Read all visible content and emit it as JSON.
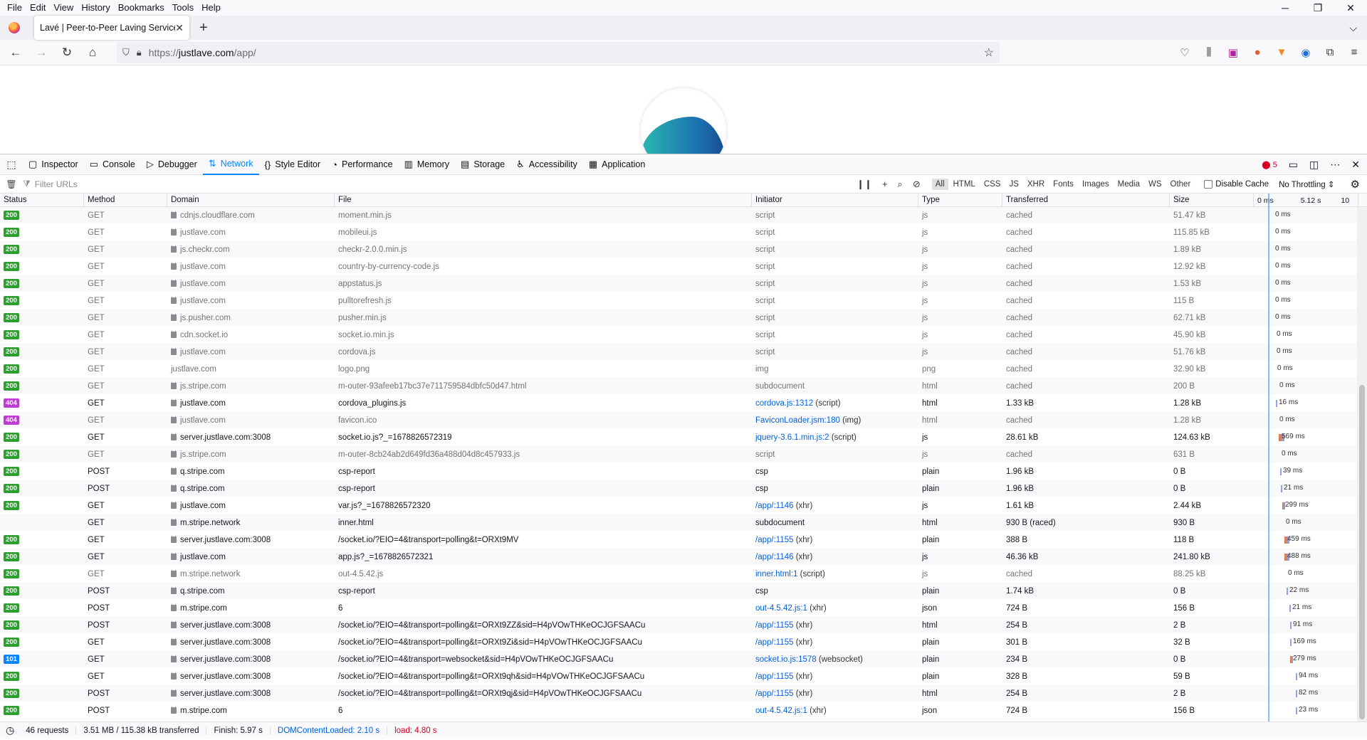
{
  "menubar": {
    "items": [
      "File",
      "Edit",
      "View",
      "History",
      "Bookmarks",
      "Tools",
      "Help"
    ]
  },
  "tab": {
    "title": "Lavé | Peer-to-Peer Laving Service"
  },
  "urlbar": {
    "url_prefix": "https://",
    "url_domain": "justlave.com",
    "url_path": "/app/"
  },
  "devtools": {
    "tabs": [
      "Inspector",
      "Console",
      "Debugger",
      "Network",
      "Style Editor",
      "Performance",
      "Memory",
      "Storage",
      "Accessibility",
      "Application"
    ],
    "active_tab": "Network",
    "error_count": "5",
    "filter_placeholder": "Filter URLs",
    "type_filters": [
      "All",
      "HTML",
      "CSS",
      "JS",
      "XHR",
      "Fonts",
      "Images",
      "Media",
      "WS",
      "Other"
    ],
    "disable_cache": "Disable Cache",
    "throttling": "No Throttling ⇕"
  },
  "columns": {
    "status": "Status",
    "method": "Method",
    "domain": "Domain",
    "file": "File",
    "initiator": "Initiator",
    "type": "Type",
    "transferred": "Transferred",
    "size": "Size",
    "wf_0": "0 ms",
    "wf_1": "5.12 s",
    "wf_2": "10"
  },
  "colors": {
    "ok": "#2e9e2e",
    "not_found": "#c03ad5",
    "switching": "#0a84ff"
  },
  "rows": [
    {
      "status": "200",
      "method": "GET",
      "secure": true,
      "domain": "cdnjs.cloudflare.com",
      "file": "moment.min.js",
      "init_link": "",
      "init_cause": "script",
      "type": "js",
      "transferred": "cached",
      "size": "51.47 kB",
      "cached": true,
      "wf_pos": 0.18,
      "wf_time": "0 ms"
    },
    {
      "status": "200",
      "method": "GET",
      "secure": true,
      "domain": "justlave.com",
      "file": "mobileui.js",
      "init_link": "",
      "init_cause": "script",
      "type": "js",
      "transferred": "cached",
      "size": "115.85 kB",
      "cached": true,
      "wf_pos": 0.18,
      "wf_time": "0 ms"
    },
    {
      "status": "200",
      "method": "GET",
      "secure": true,
      "domain": "js.checkr.com",
      "file": "checkr-2.0.0.min.js",
      "init_link": "",
      "init_cause": "script",
      "type": "js",
      "transferred": "cached",
      "size": "1.89 kB",
      "cached": true,
      "wf_pos": 0.18,
      "wf_time": "0 ms"
    },
    {
      "status": "200",
      "method": "GET",
      "secure": true,
      "domain": "justlave.com",
      "file": "country-by-currency-code.js",
      "init_link": "",
      "init_cause": "script",
      "type": "js",
      "transferred": "cached",
      "size": "12.92 kB",
      "cached": true,
      "wf_pos": 0.18,
      "wf_time": "0 ms"
    },
    {
      "status": "200",
      "method": "GET",
      "secure": true,
      "domain": "justlave.com",
      "file": "appstatus.js",
      "init_link": "",
      "init_cause": "script",
      "type": "js",
      "transferred": "cached",
      "size": "1.53 kB",
      "cached": true,
      "wf_pos": 0.18,
      "wf_time": "0 ms"
    },
    {
      "status": "200",
      "method": "GET",
      "secure": true,
      "domain": "justlave.com",
      "file": "pulltorefresh.js",
      "init_link": "",
      "init_cause": "script",
      "type": "js",
      "transferred": "cached",
      "size": "115 B",
      "cached": true,
      "wf_pos": 0.18,
      "wf_time": "0 ms"
    },
    {
      "status": "200",
      "method": "GET",
      "secure": true,
      "domain": "js.pusher.com",
      "file": "pusher.min.js",
      "init_link": "",
      "init_cause": "script",
      "type": "js",
      "transferred": "cached",
      "size": "62.71 kB",
      "cached": true,
      "wf_pos": 0.18,
      "wf_time": "0 ms"
    },
    {
      "status": "200",
      "method": "GET",
      "secure": true,
      "domain": "cdn.socket.io",
      "file": "socket.io.min.js",
      "init_link": "",
      "init_cause": "script",
      "type": "js",
      "transferred": "cached",
      "size": "45.90 kB",
      "cached": true,
      "wf_pos": 0.19,
      "wf_time": "0 ms"
    },
    {
      "status": "200",
      "method": "GET",
      "secure": true,
      "domain": "justlave.com",
      "file": "cordova.js",
      "init_link": "",
      "init_cause": "script",
      "type": "js",
      "transferred": "cached",
      "size": "51.76 kB",
      "cached": true,
      "wf_pos": 0.19,
      "wf_time": "0 ms"
    },
    {
      "status": "200",
      "method": "GET",
      "secure": false,
      "domain": "justlave.com",
      "file": "logo.png",
      "init_link": "",
      "init_cause": "img",
      "type": "png",
      "transferred": "cached",
      "size": "32.90 kB",
      "cached": true,
      "wf_pos": 0.2,
      "wf_time": "0 ms"
    },
    {
      "status": "200",
      "method": "GET",
      "secure": true,
      "domain": "js.stripe.com",
      "file": "m-outer-93afeeb17bc37e711759584dbfc50d47.html",
      "init_link": "",
      "init_cause": "subdocument",
      "type": "html",
      "transferred": "cached",
      "size": "200 B",
      "cached": true,
      "wf_pos": 0.22,
      "wf_time": "0 ms"
    },
    {
      "status": "404",
      "method": "GET",
      "secure": true,
      "domain": "justlave.com",
      "file": "cordova_plugins.js",
      "init_link": "cordova.js:1312",
      "init_cause": " (script)",
      "type": "html",
      "transferred": "1.33 kB",
      "size": "1.28 kB",
      "cached": false,
      "wf_pos": 0.21,
      "wf_time": "16 ms"
    },
    {
      "status": "404",
      "method": "GET",
      "secure": true,
      "domain": "justlave.com",
      "file": "favicon.ico",
      "init_link": "FaviconLoader.jsm:180",
      "init_cause": " (img)",
      "type": "html",
      "transferred": "cached",
      "size": "1.28 kB",
      "cached": true,
      "wf_pos": 0.22,
      "wf_time": "0 ms"
    },
    {
      "status": "200",
      "method": "GET",
      "secure": true,
      "domain": "server.justlave.com:3008",
      "file": "socket.io.js?_=1678826572319",
      "init_link": "jquery-3.6.1.min.js:2",
      "init_cause": " (script)",
      "type": "js",
      "transferred": "28.61 kB",
      "size": "124.63 kB",
      "cached": false,
      "wf_pos": 0.24,
      "wf_time": "569 ms"
    },
    {
      "status": "200",
      "method": "GET",
      "secure": true,
      "domain": "js.stripe.com",
      "file": "m-outer-8cb24ab2d649fd36a488d04d8c457933.js",
      "init_link": "",
      "init_cause": "script",
      "type": "js",
      "transferred": "cached",
      "size": "631 B",
      "cached": true,
      "wf_pos": 0.24,
      "wf_time": "0 ms"
    },
    {
      "status": "200",
      "method": "POST",
      "secure": true,
      "domain": "q.stripe.com",
      "file": "csp-report",
      "init_link": "",
      "init_cause": "csp",
      "type": "plain",
      "transferred": "1.96 kB",
      "size": "0 B",
      "cached": false,
      "wf_pos": 0.25,
      "wf_time": "39 ms"
    },
    {
      "status": "200",
      "method": "POST",
      "secure": true,
      "domain": "q.stripe.com",
      "file": "csp-report",
      "init_link": "",
      "init_cause": "csp",
      "type": "plain",
      "transferred": "1.96 kB",
      "size": "0 B",
      "cached": false,
      "wf_pos": 0.26,
      "wf_time": "21 ms"
    },
    {
      "status": "200",
      "method": "GET",
      "secure": true,
      "domain": "justlave.com",
      "file": "var.js?_=1678826572320",
      "init_link": "/app/:1146",
      "init_cause": " (xhr)",
      "type": "js",
      "transferred": "1.61 kB",
      "size": "2.44 kB",
      "cached": false,
      "wf_pos": 0.27,
      "wf_time": "299 ms"
    },
    {
      "status": "",
      "method": "GET",
      "secure": true,
      "domain": "m.stripe.network",
      "file": "inner.html",
      "init_link": "",
      "init_cause": "subdocument",
      "type": "html",
      "transferred": "930 B (raced)",
      "size": "930 B",
      "cached": false,
      "wf_pos": 0.28,
      "wf_time": "0 ms"
    },
    {
      "status": "200",
      "method": "GET",
      "secure": true,
      "domain": "server.justlave.com:3008",
      "file": "/socket.io/?EIO=4&transport=polling&t=ORXt9MV",
      "init_link": "/app/:1155",
      "init_cause": " (xhr)",
      "type": "plain",
      "transferred": "388 B",
      "size": "118 B",
      "cached": false,
      "wf_pos": 0.29,
      "wf_time": "459 ms"
    },
    {
      "status": "200",
      "method": "GET",
      "secure": true,
      "domain": "justlave.com",
      "file": "app.js?_=1678826572321",
      "init_link": "/app/:1146",
      "init_cause": " (xhr)",
      "type": "js",
      "transferred": "46.36 kB",
      "size": "241.80 kB",
      "cached": false,
      "wf_pos": 0.29,
      "wf_time": "488 ms"
    },
    {
      "status": "200",
      "method": "GET",
      "secure": true,
      "domain": "m.stripe.network",
      "file": "out-4.5.42.js",
      "init_link": "inner.html:1",
      "init_cause": " (script)",
      "type": "js",
      "transferred": "cached",
      "size": "88.25 kB",
      "cached": true,
      "wf_pos": 0.3,
      "wf_time": "0 ms"
    },
    {
      "status": "200",
      "method": "POST",
      "secure": true,
      "domain": "q.stripe.com",
      "file": "csp-report",
      "init_link": "",
      "init_cause": "csp",
      "type": "plain",
      "transferred": "1.74 kB",
      "size": "0 B",
      "cached": false,
      "wf_pos": 0.31,
      "wf_time": "22 ms"
    },
    {
      "status": "200",
      "method": "POST",
      "secure": true,
      "domain": "m.stripe.com",
      "file": "6",
      "init_link": "out-4.5.42.js:1",
      "init_cause": " (xhr)",
      "type": "json",
      "transferred": "724 B",
      "size": "156 B",
      "cached": false,
      "wf_pos": 0.34,
      "wf_time": "21 ms"
    },
    {
      "status": "200",
      "method": "POST",
      "secure": true,
      "domain": "server.justlave.com:3008",
      "file": "/socket.io/?EIO=4&transport=polling&t=ORXt9ZZ&sid=H4pVOwTHKeOCJGFSAACu",
      "init_link": "/app/:1155",
      "init_cause": " (xhr)",
      "type": "html",
      "transferred": "254 B",
      "size": "2 B",
      "cached": false,
      "wf_pos": 0.35,
      "wf_time": "91 ms"
    },
    {
      "status": "200",
      "method": "GET",
      "secure": true,
      "domain": "server.justlave.com:3008",
      "file": "/socket.io/?EIO=4&transport=polling&t=ORXt9Zi&sid=H4pVOwTHKeOCJGFSAACu",
      "init_link": "/app/:1155",
      "init_cause": " (xhr)",
      "type": "plain",
      "transferred": "301 B",
      "size": "32 B",
      "cached": false,
      "wf_pos": 0.35,
      "wf_time": "169 ms"
    },
    {
      "status": "101",
      "method": "GET",
      "secure": true,
      "domain": "server.justlave.com:3008",
      "file": "/socket.io/?EIO=4&transport=websocket&sid=H4pVOwTHKeOCJGFSAACu",
      "init_link": "socket.io.js:1578",
      "init_cause": " (websocket)",
      "type": "plain",
      "transferred": "234 B",
      "size": "0 B",
      "cached": false,
      "wf_pos": 0.35,
      "wf_time": "279 ms"
    },
    {
      "status": "200",
      "method": "GET",
      "secure": true,
      "domain": "server.justlave.com:3008",
      "file": "/socket.io/?EIO=4&transport=polling&t=ORXt9qh&sid=H4pVOwTHKeOCJGFSAACu",
      "init_link": "/app/:1155",
      "init_cause": " (xhr)",
      "type": "plain",
      "transferred": "328 B",
      "size": "59 B",
      "cached": false,
      "wf_pos": 0.4,
      "wf_time": "94 ms"
    },
    {
      "status": "200",
      "method": "POST",
      "secure": true,
      "domain": "server.justlave.com:3008",
      "file": "/socket.io/?EIO=4&transport=polling&t=ORXt9qj&sid=H4pVOwTHKeOCJGFSAACu",
      "init_link": "/app/:1155",
      "init_cause": " (xhr)",
      "type": "html",
      "transferred": "254 B",
      "size": "2 B",
      "cached": false,
      "wf_pos": 0.4,
      "wf_time": "82 ms"
    },
    {
      "status": "200",
      "method": "POST",
      "secure": true,
      "domain": "m.stripe.com",
      "file": "6",
      "init_link": "out-4.5.42.js:1",
      "init_cause": " (xhr)",
      "type": "json",
      "transferred": "724 B",
      "size": "156 B",
      "cached": false,
      "wf_pos": 0.4,
      "wf_time": "23 ms"
    }
  ],
  "statusbar": {
    "requests": "46 requests",
    "transferred": "3.51 MB / 115.38 kB transferred",
    "finish": "Finish: 5.97 s",
    "dcl": "DOMContentLoaded: 2.10 s",
    "load": "load: 4.80 s"
  }
}
